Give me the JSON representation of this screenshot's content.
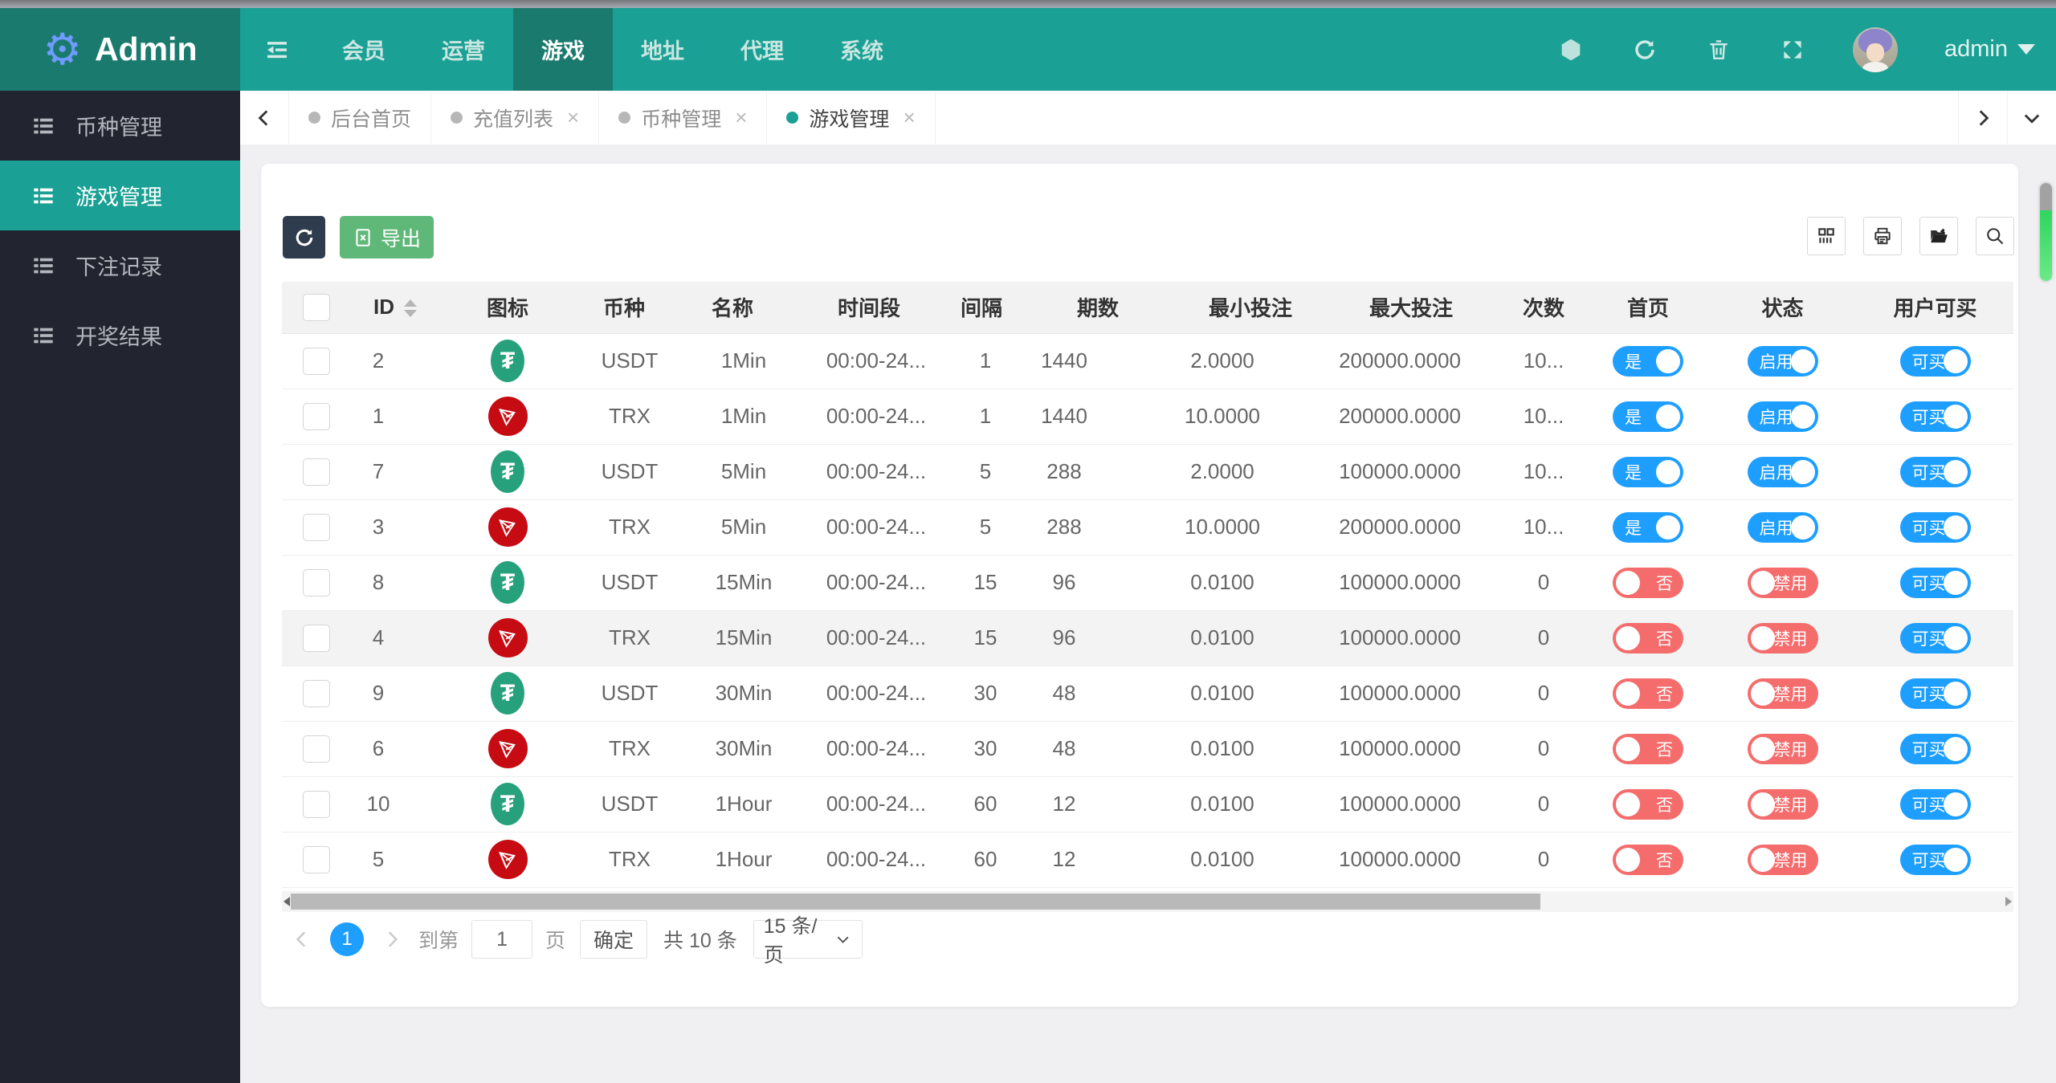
{
  "header": {
    "brand": "Admin",
    "menu": [
      {
        "label": "会员",
        "active": false
      },
      {
        "label": "运营",
        "active": false
      },
      {
        "label": "游戏",
        "active": true
      },
      {
        "label": "地址",
        "active": false
      },
      {
        "label": "代理",
        "active": false
      },
      {
        "label": "系统",
        "active": false
      }
    ],
    "username": "admin"
  },
  "sidebar": {
    "items": [
      {
        "label": "币种管理",
        "active": false
      },
      {
        "label": "游戏管理",
        "active": true
      },
      {
        "label": "下注记录",
        "active": false
      },
      {
        "label": "开奖结果",
        "active": false
      }
    ]
  },
  "tabbar": {
    "tabs": [
      {
        "label": "后台首页",
        "closable": false,
        "active": false
      },
      {
        "label": "充值列表",
        "closable": true,
        "active": false
      },
      {
        "label": "币种管理",
        "closable": true,
        "active": false
      },
      {
        "label": "游戏管理",
        "closable": true,
        "active": true
      }
    ]
  },
  "toolbar": {
    "export_label": "导出"
  },
  "table": {
    "columns": [
      "ID",
      "图标",
      "币种",
      "名称",
      "时间段",
      "间隔",
      "期数",
      "最小投注",
      "最大投注",
      "次数",
      "首页",
      "状态",
      "用户可买"
    ],
    "rows": [
      {
        "id": "2",
        "coin": "USDT",
        "name": "1Min",
        "period": "00:00-24...",
        "interval": "1",
        "issues": "1440",
        "min_bet": "2.0000",
        "max_bet": "200000.0000",
        "times": "10...",
        "home_label": "是",
        "home_on": true,
        "status_label": "启用",
        "status_on": true,
        "buy_label": "可买",
        "buy_on": true,
        "highlight": false
      },
      {
        "id": "1",
        "coin": "TRX",
        "name": "1Min",
        "period": "00:00-24...",
        "interval": "1",
        "issues": "1440",
        "min_bet": "10.0000",
        "max_bet": "200000.0000",
        "times": "10...",
        "home_label": "是",
        "home_on": true,
        "status_label": "启用",
        "status_on": true,
        "buy_label": "可买",
        "buy_on": true,
        "highlight": false
      },
      {
        "id": "7",
        "coin": "USDT",
        "name": "5Min",
        "period": "00:00-24...",
        "interval": "5",
        "issues": "288",
        "min_bet": "2.0000",
        "max_bet": "100000.0000",
        "times": "10...",
        "home_label": "是",
        "home_on": true,
        "status_label": "启用",
        "status_on": true,
        "buy_label": "可买",
        "buy_on": true,
        "highlight": false
      },
      {
        "id": "3",
        "coin": "TRX",
        "name": "5Min",
        "period": "00:00-24...",
        "interval": "5",
        "issues": "288",
        "min_bet": "10.0000",
        "max_bet": "200000.0000",
        "times": "10...",
        "home_label": "是",
        "home_on": true,
        "status_label": "启用",
        "status_on": true,
        "buy_label": "可买",
        "buy_on": true,
        "highlight": false
      },
      {
        "id": "8",
        "coin": "USDT",
        "name": "15Min",
        "period": "00:00-24...",
        "interval": "15",
        "issues": "96",
        "min_bet": "0.0100",
        "max_bet": "100000.0000",
        "times": "0",
        "home_label": "否",
        "home_on": false,
        "status_label": "禁用",
        "status_on": false,
        "buy_label": "可买",
        "buy_on": true,
        "highlight": false
      },
      {
        "id": "4",
        "coin": "TRX",
        "name": "15Min",
        "period": "00:00-24...",
        "interval": "15",
        "issues": "96",
        "min_bet": "0.0100",
        "max_bet": "100000.0000",
        "times": "0",
        "home_label": "否",
        "home_on": false,
        "status_label": "禁用",
        "status_on": false,
        "buy_label": "可买",
        "buy_on": true,
        "highlight": true
      },
      {
        "id": "9",
        "coin": "USDT",
        "name": "30Min",
        "period": "00:00-24...",
        "interval": "30",
        "issues": "48",
        "min_bet": "0.0100",
        "max_bet": "100000.0000",
        "times": "0",
        "home_label": "否",
        "home_on": false,
        "status_label": "禁用",
        "status_on": false,
        "buy_label": "可买",
        "buy_on": true,
        "highlight": false
      },
      {
        "id": "6",
        "coin": "TRX",
        "name": "30Min",
        "period": "00:00-24...",
        "interval": "30",
        "issues": "48",
        "min_bet": "0.0100",
        "max_bet": "100000.0000",
        "times": "0",
        "home_label": "否",
        "home_on": false,
        "status_label": "禁用",
        "status_on": false,
        "buy_label": "可买",
        "buy_on": true,
        "highlight": false
      },
      {
        "id": "10",
        "coin": "USDT",
        "name": "1Hour",
        "period": "00:00-24...",
        "interval": "60",
        "issues": "12",
        "min_bet": "0.0100",
        "max_bet": "100000.0000",
        "times": "0",
        "home_label": "否",
        "home_on": false,
        "status_label": "禁用",
        "status_on": false,
        "buy_label": "可买",
        "buy_on": true,
        "highlight": false
      },
      {
        "id": "5",
        "coin": "TRX",
        "name": "1Hour",
        "period": "00:00-24...",
        "interval": "60",
        "issues": "12",
        "min_bet": "0.0100",
        "max_bet": "100000.0000",
        "times": "0",
        "home_label": "否",
        "home_on": false,
        "status_label": "禁用",
        "status_on": false,
        "buy_label": "可买",
        "buy_on": true,
        "highlight": false
      }
    ]
  },
  "pagination": {
    "current": "1",
    "goto_label": "到第",
    "goto_value": "1",
    "page_label": "页",
    "confirm_label": "确定",
    "total_label": "共 10 条",
    "per_page_label": "15 条/页"
  },
  "colors": {
    "accent_teal": "#1AA094",
    "teal_dark": "#1B7A6E",
    "sidebar_bg": "#222530",
    "toggle_on_blue": "#1E9FFF",
    "toggle_off_red": "#F56C6C",
    "export_green": "#5FB878",
    "refresh_dark": "#2F3C4E",
    "usdt_green": "#26A17B",
    "trx_red": "#C60B13"
  }
}
